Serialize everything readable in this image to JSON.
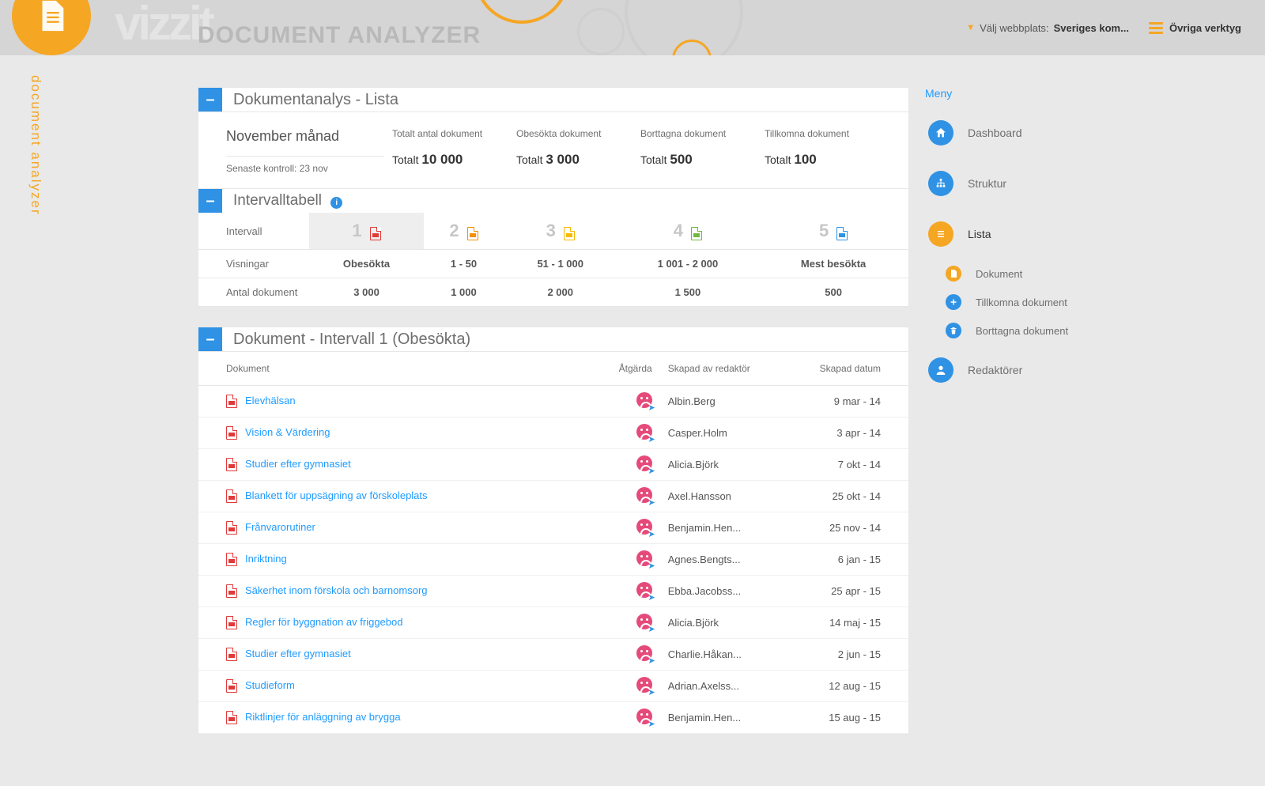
{
  "header": {
    "brand": "vizzit",
    "product": "DOCUMENT ANALYZER",
    "site_label": "Välj webbplats:",
    "site_value": "Sveriges kom...",
    "tools_label": "Övriga verktyg",
    "strip": "document analyzer"
  },
  "panel1": {
    "title": "Dokumentanalys - Lista",
    "period_title": "November månad",
    "period_sub": "Senaste kontroll: 23 nov",
    "metrics": [
      {
        "label": "Totalt antal dokument",
        "prefix": "Totalt",
        "value": "10 000"
      },
      {
        "label": "Obesökta dokument",
        "prefix": "Totalt",
        "value": "3 000"
      },
      {
        "label": "Borttagna dokument",
        "prefix": "Totalt",
        "value": "500"
      },
      {
        "label": "Tillkomna dokument",
        "prefix": "Totalt",
        "value": "100"
      }
    ]
  },
  "panel2": {
    "title": "Intervalltabell",
    "row_labels": {
      "r0": "Intervall",
      "r1": "Visningar",
      "r2": "Antal dokument"
    },
    "cols": [
      {
        "n": "1",
        "views": "Obesökta",
        "docs": "3 000",
        "active": true,
        "color": "fi-red"
      },
      {
        "n": "2",
        "views": "1 - 50",
        "docs": "1 000",
        "color": "fi-orange"
      },
      {
        "n": "3",
        "views": "51 - 1 000",
        "docs": "2 000",
        "color": "fi-yellow"
      },
      {
        "n": "4",
        "views": "1 001 - 2 000",
        "docs": "1 500",
        "color": "fi-green"
      },
      {
        "n": "5",
        "views": "Mest besökta",
        "docs": "500",
        "color": "fi-blue"
      }
    ]
  },
  "panel3": {
    "title": "Dokument - Intervall 1 (Obesökta)",
    "cols": {
      "doc": "Dokument",
      "action": "Åtgärda",
      "editor": "Skapad av redaktör",
      "date": "Skapad datum"
    },
    "rows": [
      {
        "name": "Elevhälsan",
        "editor": "Albin.Berg",
        "date": "9 mar - 14"
      },
      {
        "name": "Vision & Värdering",
        "editor": "Casper.Holm",
        "date": "3 apr - 14"
      },
      {
        "name": "Studier efter gymnasiet",
        "editor": "Alicia.Björk",
        "date": "7 okt - 14"
      },
      {
        "name": "Blankett för uppsägning av förskoleplats",
        "editor": "Axel.Hansson",
        "date": "25 okt - 14"
      },
      {
        "name": "Frånvarorutiner",
        "editor": "Benjamin.Hen...",
        "date": "25 nov - 14"
      },
      {
        "name": "Inriktning",
        "editor": "Agnes.Bengts...",
        "date": "6 jan - 15"
      },
      {
        "name": "Säkerhet inom förskola och barnomsorg",
        "editor": "Ebba.Jacobss...",
        "date": "25 apr - 15"
      },
      {
        "name": "Regler för byggnation av friggebod",
        "editor": "Alicia.Björk",
        "date": "14 maj - 15"
      },
      {
        "name": "Studier efter gymnasiet",
        "editor": "Charlie.Håkan...",
        "date": "2 jun - 15"
      },
      {
        "name": "Studieform",
        "editor": "Adrian.Axelss...",
        "date": "12 aug - 15"
      },
      {
        "name": "Riktlinjer för anläggning av brygga",
        "editor": "Benjamin.Hen...",
        "date": "15 aug - 15"
      }
    ]
  },
  "menu": {
    "title": "Meny",
    "items": [
      {
        "label": "Dashboard",
        "icon": "home",
        "color": "mi-blue"
      },
      {
        "label": "Struktur",
        "icon": "tree",
        "color": "mi-blue"
      },
      {
        "label": "Lista",
        "icon": "list",
        "color": "mi-orange",
        "active": true
      },
      {
        "label": "Dokument",
        "icon": "doc",
        "color": "mi-orange",
        "sub": true
      },
      {
        "label": "Tillkomna dokument",
        "icon": "plus",
        "color": "mi-blue",
        "sub": true
      },
      {
        "label": "Borttagna dokument",
        "icon": "trash",
        "color": "mi-blue",
        "sub": true
      },
      {
        "label": "Redaktörer",
        "icon": "user",
        "color": "mi-blue"
      }
    ]
  }
}
